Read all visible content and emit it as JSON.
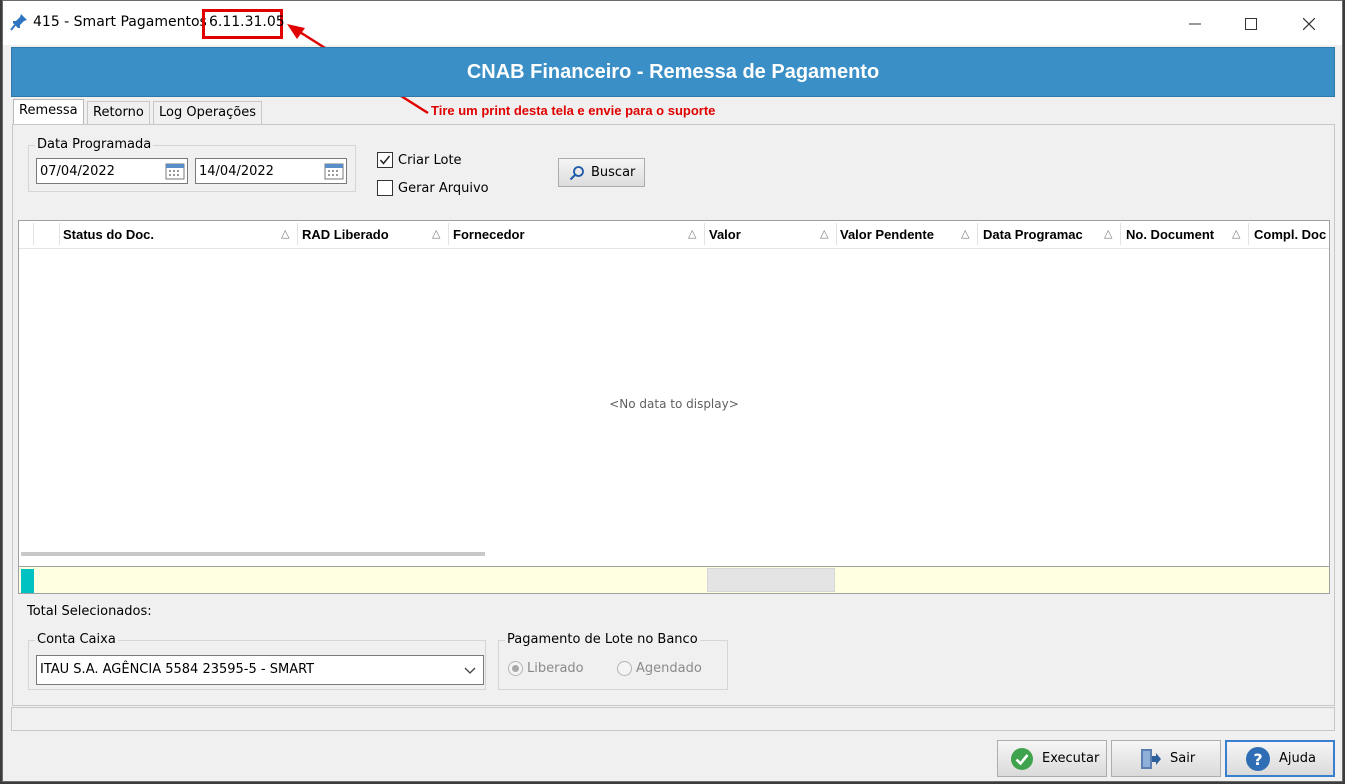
{
  "window": {
    "title": "415 - Smart Pagamentos",
    "version": "6.11.31.05"
  },
  "header": {
    "title": "CNAB Financeiro - Remessa de Pagamento"
  },
  "annotation": {
    "text": "Tire um print desta tela e envie para o suporte",
    "color": "#e00000"
  },
  "tabs": [
    {
      "label": "Remessa"
    },
    {
      "label": "Retorno"
    },
    {
      "label": "Log Operações"
    }
  ],
  "filters": {
    "data_programada_label": "Data Programada",
    "date_from": "07/04/2022",
    "date_to": "14/04/2022",
    "criar_lote_label": "Criar Lote",
    "criar_lote_checked": true,
    "gerar_arquivo_label": "Gerar Arquivo",
    "gerar_arquivo_checked": false,
    "buscar_label": "Buscar"
  },
  "grid": {
    "columns": [
      {
        "label": "Status do Doc."
      },
      {
        "label": "RAD Liberado"
      },
      {
        "label": "Fornecedor"
      },
      {
        "label": "Valor"
      },
      {
        "label": "Valor Pendente"
      },
      {
        "label": "Data Programac"
      },
      {
        "label": "No. Document"
      },
      {
        "label": "Compl. Doc"
      }
    ],
    "empty_text": "<No data to display>"
  },
  "totals": {
    "label": "Total Selecionados:"
  },
  "conta_caixa": {
    "label": "Conta Caixa",
    "value": "ITAU S.A. AGÊNCIA 5584 23595-5 - SMART"
  },
  "pagamento_lote": {
    "label": "Pagamento de Lote no Banco",
    "options": [
      "Liberado",
      "Agendado"
    ],
    "selected": "Liberado"
  },
  "buttons": {
    "executar": "Executar",
    "sair": "Sair",
    "ajuda": "Ajuda"
  },
  "colors": {
    "header_band": "#3a8fc6",
    "footer_bar": "#ffffe1",
    "accent_cyan": "#00c2c2"
  }
}
